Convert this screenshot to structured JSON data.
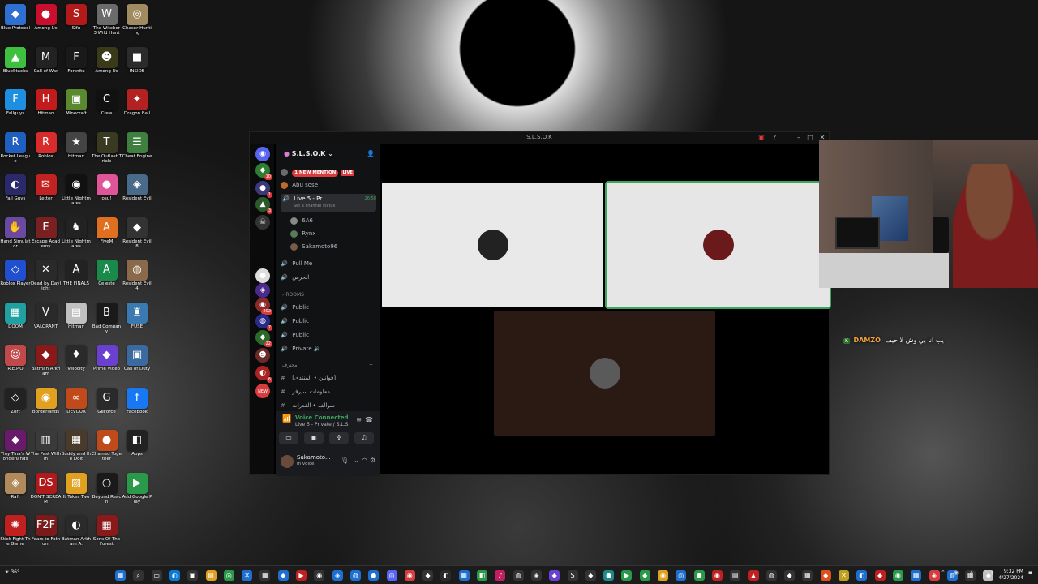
{
  "desktop": {
    "icons": [
      {
        "label": "Blue Protocol",
        "glyph": "◆",
        "color": "#2f6fd1"
      },
      {
        "label": "Among Us",
        "glyph": "●",
        "color": "#c8102e"
      },
      {
        "label": "Sifu",
        "glyph": "S",
        "color": "#b31b1b"
      },
      {
        "label": "The Witcher 3 Wild Hunt",
        "glyph": "W",
        "color": "#6b6b6b"
      },
      {
        "label": "Chaser Hunting",
        "glyph": "◎",
        "color": "#a08c60"
      },
      {
        "label": "BlueStacks",
        "glyph": "▲",
        "color": "#3fbf3f"
      },
      {
        "label": "Call of War",
        "glyph": "M",
        "color": "#222222"
      },
      {
        "label": "Fortnite",
        "glyph": "F",
        "color": "#1a1a1a"
      },
      {
        "label": "Among Us",
        "glyph": "☻",
        "color": "#3a3a1a"
      },
      {
        "label": "INSIDE",
        "glyph": "■",
        "color": "#2b2b2b"
      },
      {
        "label": "Fallguys",
        "glyph": "F",
        "color": "#1e8ee0"
      },
      {
        "label": "Hitman",
        "glyph": "H",
        "color": "#c21b1b"
      },
      {
        "label": "Minecraft",
        "glyph": "▣",
        "color": "#5a8a2f"
      },
      {
        "label": "Crew",
        "glyph": "C",
        "color": "#111111"
      },
      {
        "label": "Dragon Ball",
        "glyph": "✦",
        "color": "#b22222"
      },
      {
        "label": "Rocket League",
        "glyph": "R",
        "color": "#1f5fbf"
      },
      {
        "label": "Roblox",
        "glyph": "R",
        "color": "#d82c2c"
      },
      {
        "label": "Hitman",
        "glyph": "★",
        "color": "#444444"
      },
      {
        "label": "The Outlast Trials",
        "glyph": "T",
        "color": "#3a3a22"
      },
      {
        "label": "Cheat Engine",
        "glyph": "☰",
        "color": "#3f7f3f"
      },
      {
        "label": "Fall Guys",
        "glyph": "◐",
        "color": "#2a2a6a"
      },
      {
        "label": "Letter",
        "glyph": "✉",
        "color": "#c22222"
      },
      {
        "label": "Little Nightmares",
        "glyph": "◉",
        "color": "#111111"
      },
      {
        "label": "osu!",
        "glyph": "●",
        "color": "#e0559a"
      },
      {
        "label": "Resident Evil",
        "glyph": "◈",
        "color": "#4a6a8a"
      },
      {
        "label": "Hand Simulator",
        "glyph": "✋",
        "color": "#6a4aa0"
      },
      {
        "label": "Escape Academy",
        "glyph": "E",
        "color": "#7a2020"
      },
      {
        "label": "Little Nightmares",
        "glyph": "♞",
        "color": "#222222"
      },
      {
        "label": "FiveM",
        "glyph": "A",
        "color": "#e07020"
      },
      {
        "label": "Resident Evil 8",
        "glyph": "◆",
        "color": "#333333"
      },
      {
        "label": "Roblox Player",
        "glyph": "◇",
        "color": "#2050d0"
      },
      {
        "label": "Dead by Daylight",
        "glyph": "✕",
        "color": "#2a2a2a"
      },
      {
        "label": "THE FINALS",
        "glyph": "A",
        "color": "#222222"
      },
      {
        "label": "Celeste",
        "glyph": "A",
        "color": "#1a8a4a"
      },
      {
        "label": "Resident Evil 4",
        "glyph": "◍",
        "color": "#8a6a4a"
      },
      {
        "label": "DOOM",
        "glyph": "▦",
        "color": "#20a0a0"
      },
      {
        "label": "VALORANT",
        "glyph": "V",
        "color": "#2a2a2a"
      },
      {
        "label": "Hitman",
        "glyph": "▤",
        "color": "#c0c0c0"
      },
      {
        "label": "Bad Company",
        "glyph": "B",
        "color": "#1a1a1a"
      },
      {
        "label": "FUSE",
        "glyph": "♜",
        "color": "#3a7ab0"
      },
      {
        "label": "R.E.P.O",
        "glyph": "☺",
        "color": "#c04a4a"
      },
      {
        "label": "Batman Arkham",
        "glyph": "◆",
        "color": "#8a1a1a"
      },
      {
        "label": "Velocity",
        "glyph": "♦",
        "color": "#2a2a2a"
      },
      {
        "label": "Prime Video",
        "glyph": "◆",
        "color": "#6a40d0"
      },
      {
        "label": "Call of Duty",
        "glyph": "▣",
        "color": "#3a6aa0"
      },
      {
        "label": "Zort",
        "glyph": "◇",
        "color": "#222222"
      },
      {
        "label": "Borderlands",
        "glyph": "◉",
        "color": "#e0a020"
      },
      {
        "label": "DEVOUR",
        "glyph": "∞",
        "color": "#c04a1a"
      },
      {
        "label": "GeForce",
        "glyph": "G",
        "color": "#2a2a2a"
      },
      {
        "label": "Facebook",
        "glyph": "f",
        "color": "#1877f2"
      },
      {
        "label": "Tiny Tina's Wonderlands",
        "glyph": "◆",
        "color": "#6a1a6a"
      },
      {
        "label": "The Past Within",
        "glyph": "▥",
        "color": "#3a3a3a"
      },
      {
        "label": "Buddy and the Dolt",
        "glyph": "▦",
        "color": "#4a3a2a"
      },
      {
        "label": "Chained Together",
        "glyph": "●",
        "color": "#c04a1a"
      },
      {
        "label": "Apps",
        "glyph": "◧",
        "color": "#222222"
      },
      {
        "label": "Raft",
        "glyph": "◈",
        "color": "#b08a5a"
      },
      {
        "label": "DON'T SCREAM",
        "glyph": "DS",
        "color": "#b01a1a"
      },
      {
        "label": "It Takes Two",
        "glyph": "▨",
        "color": "#e0a020"
      },
      {
        "label": "Beyond Reach",
        "glyph": "○",
        "color": "#1a1a1a"
      },
      {
        "label": "Add Google Play",
        "glyph": "▶",
        "color": "#2a9a4a"
      },
      {
        "label": "Stick Fight The Game",
        "glyph": "✺",
        "color": "#c02020"
      },
      {
        "label": "Fears to Fathom",
        "glyph": "F2F",
        "color": "#7a1a1a"
      },
      {
        "label": "Batman Arkham A.",
        "glyph": "◐",
        "color": "#2a2a2a"
      },
      {
        "label": "Sons Of The Forest",
        "glyph": "▦",
        "color": "#8a1a1a"
      }
    ]
  },
  "window": {
    "title": "S.L.S.O.K",
    "controls": [
      "minimize",
      "maximize",
      "close"
    ]
  },
  "servers": [
    {
      "color": "#5865f2",
      "glyph": "◉",
      "badge": ""
    },
    {
      "color": "#2e7d32",
      "glyph": "◆",
      "badge": "10"
    },
    {
      "color": "#3a3a7a",
      "glyph": "●",
      "badge": "1"
    },
    {
      "color": "#2a5a2a",
      "glyph": "▲",
      "badge": "3"
    },
    {
      "color": "#333333",
      "glyph": "☠",
      "badge": ""
    },
    {
      "color": "#dddddd",
      "glyph": "●",
      "badge": ""
    },
    {
      "color": "#4a2a8a",
      "glyph": "◈",
      "badge": ""
    },
    {
      "color": "#8a2a2a",
      "glyph": "◉",
      "badge": "202"
    },
    {
      "color": "#2a2a8a",
      "glyph": "◍",
      "badge": "7"
    },
    {
      "color": "#2a6a2a",
      "glyph": "◆",
      "badge": "22"
    },
    {
      "color": "#6a2a2a",
      "glyph": "☻",
      "badge": ""
    },
    {
      "color": "#aa2222",
      "glyph": "◐",
      "badge": "6"
    },
    {
      "color": "#d83c3e",
      "glyph": "NEW",
      "badge": ""
    }
  ],
  "guild": {
    "name": "S.L.S.O.K",
    "new_mention": "1 NEW MENTION",
    "live": "LIVE",
    "channels": {
      "abu_sose": "Abu sose",
      "live5": "Live 5 - Pr...",
      "live5_time": "26:58",
      "live5_status": "Set a channel status",
      "member1": "6A6",
      "member2": "Rynx",
      "member3": "Sakamoto96",
      "pull_me": "Pull Me",
      "arabic_chan": "الحرس",
      "rooms": "ROOMS",
      "public1": "Public",
      "public2": "Public",
      "public3": "Public",
      "private": "Private",
      "text_cat": "محترف",
      "text1": "[قوانين • المنتدى]",
      "text2": "معلومات سيرفر",
      "text3": "سوالف • القدرات"
    }
  },
  "voice": {
    "status": "Voice Connected",
    "channel": "Live 5 - Private / S.L.S"
  },
  "user": {
    "name": "Sakamoto...",
    "status": "In voice"
  },
  "tiles": [
    {
      "bg": "#e9e9e9",
      "pfp": "#222222",
      "highlight": false
    },
    {
      "bg": "#e6e6e6",
      "pfp": "#6a1a1a",
      "highlight": true
    },
    {
      "bg": "#2b1a14",
      "pfp": "#5a5a5a",
      "highlight": false
    }
  ],
  "chat": {
    "badge": "K",
    "name": "DAMZO",
    "message": "يب انا بي وش لا حيف"
  },
  "taskbar": {
    "weather_temp": "36°",
    "time": "9:32 PM",
    "date": "4/27/2024",
    "apps": [
      {
        "glyph": "▦",
        "color": "#1f6fd1"
      },
      {
        "glyph": "⌕",
        "color": "#333333"
      },
      {
        "glyph": "▭",
        "color": "#333333"
      },
      {
        "glyph": "◐",
        "color": "#0a7ad4"
      },
      {
        "glyph": "▣",
        "color": "#333333"
      },
      {
        "glyph": "▤",
        "color": "#e0a020"
      },
      {
        "glyph": "◎",
        "color": "#2a9a4a"
      },
      {
        "glyph": "✕",
        "color": "#1f6fd1"
      },
      {
        "glyph": "▦",
        "color": "#333333"
      },
      {
        "glyph": "◆",
        "color": "#1f6fd1"
      },
      {
        "glyph": "▶",
        "color": "#c02020"
      },
      {
        "glyph": "◉",
        "color": "#333333"
      },
      {
        "glyph": "◈",
        "color": "#1f6fd1"
      },
      {
        "glyph": "◍",
        "color": "#1f6fd1"
      },
      {
        "glyph": "●",
        "color": "#1f6fd1"
      },
      {
        "glyph": "◎",
        "color": "#5865f2"
      },
      {
        "glyph": "◉",
        "color": "#d83c3e"
      },
      {
        "glyph": "◆",
        "color": "#333333"
      },
      {
        "glyph": "◐",
        "color": "#2a2a2a"
      },
      {
        "glyph": "▦",
        "color": "#1f6fd1"
      },
      {
        "glyph": "◧",
        "color": "#2a9a4a"
      },
      {
        "glyph": "♪",
        "color": "#c02060"
      },
      {
        "glyph": "◍",
        "color": "#333333"
      },
      {
        "glyph": "◈",
        "color": "#333333"
      },
      {
        "glyph": "◆",
        "color": "#6a40d0"
      },
      {
        "glyph": "S",
        "color": "#333333"
      },
      {
        "glyph": "◆",
        "color": "#333333"
      },
      {
        "glyph": "●",
        "color": "#1f8a8a"
      },
      {
        "glyph": "▶",
        "color": "#2a9a4a"
      },
      {
        "glyph": "◆",
        "color": "#2a9a4a"
      },
      {
        "glyph": "◉",
        "color": "#e0a020"
      },
      {
        "glyph": "◎",
        "color": "#1f6fd1"
      },
      {
        "glyph": "●",
        "color": "#2a9a4a"
      },
      {
        "glyph": "◉",
        "color": "#c02020"
      },
      {
        "glyph": "▤",
        "color": "#333333"
      },
      {
        "glyph": "▲",
        "color": "#c02020"
      },
      {
        "glyph": "◍",
        "color": "#333333"
      },
      {
        "glyph": "◆",
        "color": "#333333"
      },
      {
        "glyph": "▦",
        "color": "#333333"
      },
      {
        "glyph": "◆",
        "color": "#e0501a"
      },
      {
        "glyph": "✕",
        "color": "#c0a020"
      },
      {
        "glyph": "◐",
        "color": "#1f6fd1"
      },
      {
        "glyph": "◆",
        "color": "#c02020"
      },
      {
        "glyph": "◉",
        "color": "#2a9a4a"
      },
      {
        "glyph": "▦",
        "color": "#1f6fd1"
      },
      {
        "glyph": "◈",
        "color": "#d83c3e"
      },
      {
        "glyph": "◍",
        "color": "#1f6fd1"
      },
      {
        "glyph": "▦",
        "color": "#333333"
      },
      {
        "glyph": "◆",
        "color": "#c0c0c0"
      }
    ]
  }
}
